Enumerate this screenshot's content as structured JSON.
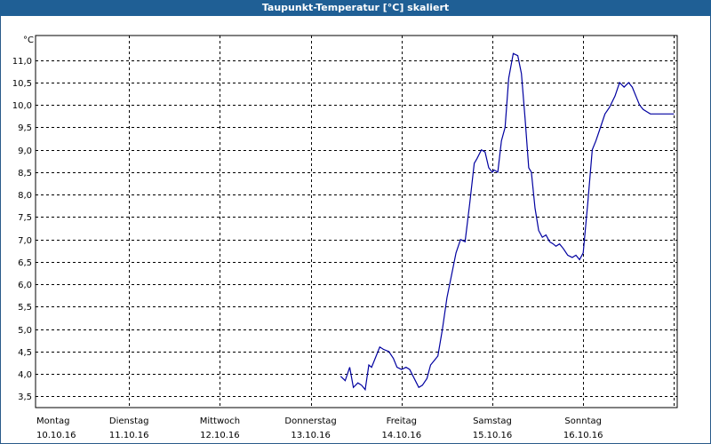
{
  "window": {
    "title": "Taupunkt-Temperatur [°C] skaliert"
  },
  "chart_data": {
    "type": "line",
    "title": "Taupunkt-Temperatur [°C] skaliert",
    "ylabel": "°C",
    "ylim": [
      3.25,
      11.55
    ],
    "yticks": [
      "3,5",
      "4,0",
      "4,5",
      "5,0",
      "5,5",
      "6,0",
      "6,5",
      "7,0",
      "7,5",
      "8,0",
      "8,5",
      "9,0",
      "9,5",
      "10,0",
      "10,5",
      "11,0"
    ],
    "ytick_values": [
      3.5,
      4.0,
      4.5,
      5.0,
      5.5,
      6.0,
      6.5,
      7.0,
      7.5,
      8.0,
      8.5,
      9.0,
      9.5,
      10.0,
      10.5,
      11.0
    ],
    "xlim": [
      0,
      7.0
    ],
    "xticks": [
      {
        "day": "Montag",
        "date": "10.10.16",
        "pos": 0
      },
      {
        "day": "Dienstag",
        "date": "11.10.16",
        "pos": 1
      },
      {
        "day": "Mittwoch",
        "date": "12.10.16",
        "pos": 2
      },
      {
        "day": "Donnerstag",
        "date": "13.10.16",
        "pos": 3
      },
      {
        "day": "Freitag",
        "date": "14.10.16",
        "pos": 4
      },
      {
        "day": "Samstag",
        "date": "15.10.16",
        "pos": 5
      },
      {
        "day": "Sonntag",
        "date": "16.10.16",
        "pos": 6
      }
    ],
    "grid": true,
    "series": [
      {
        "color": "#0000a0",
        "x": [
          3.33,
          3.38,
          3.43,
          3.47,
          3.52,
          3.56,
          3.6,
          3.64,
          3.67,
          3.71,
          3.76,
          3.8,
          3.86,
          3.91,
          3.95,
          4.0,
          4.05,
          4.09,
          4.14,
          4.19,
          4.23,
          4.28,
          4.32,
          4.36,
          4.4,
          4.45,
          4.5,
          4.55,
          4.6,
          4.65,
          4.7,
          4.75,
          4.8,
          4.83,
          4.88,
          4.92,
          4.96,
          5.0,
          5.02,
          5.06,
          5.1,
          5.14,
          5.18,
          5.23,
          5.28,
          5.32,
          5.36,
          5.4,
          5.43,
          5.47,
          5.51,
          5.55,
          5.59,
          5.63,
          5.67,
          5.7,
          5.74,
          5.78,
          5.83,
          5.88,
          5.92,
          5.96,
          6.0,
          6.05,
          6.1,
          6.14,
          6.19,
          6.24,
          6.29,
          6.35,
          6.4,
          6.45,
          6.5,
          6.54,
          6.58,
          6.62,
          6.66,
          6.7,
          6.74,
          6.78,
          6.82,
          6.86,
          6.91,
          6.96,
          7.0
        ],
        "y": [
          3.95,
          3.85,
          4.15,
          3.7,
          3.8,
          3.75,
          3.65,
          4.2,
          4.15,
          4.35,
          4.6,
          4.55,
          4.5,
          4.35,
          4.15,
          4.1,
          4.15,
          4.1,
          3.9,
          3.7,
          3.75,
          3.9,
          4.2,
          4.3,
          4.4,
          5.0,
          5.7,
          6.2,
          6.7,
          7.0,
          6.95,
          7.8,
          8.7,
          8.8,
          9.0,
          8.95,
          8.6,
          8.5,
          8.55,
          8.5,
          9.2,
          9.5,
          10.6,
          11.15,
          11.1,
          10.7,
          9.7,
          8.6,
          8.5,
          7.7,
          7.2,
          7.05,
          7.1,
          6.95,
          6.9,
          6.85,
          6.9,
          6.8,
          6.65,
          6.6,
          6.65,
          6.55,
          6.7,
          7.8,
          9.0,
          9.2,
          9.5,
          9.8,
          9.95,
          10.2,
          10.5,
          10.4,
          10.5,
          10.4,
          10.2,
          10.0,
          9.9,
          9.85,
          9.8,
          9.8,
          9.8,
          9.8,
          9.8,
          9.8,
          9.8
        ]
      }
    ]
  }
}
